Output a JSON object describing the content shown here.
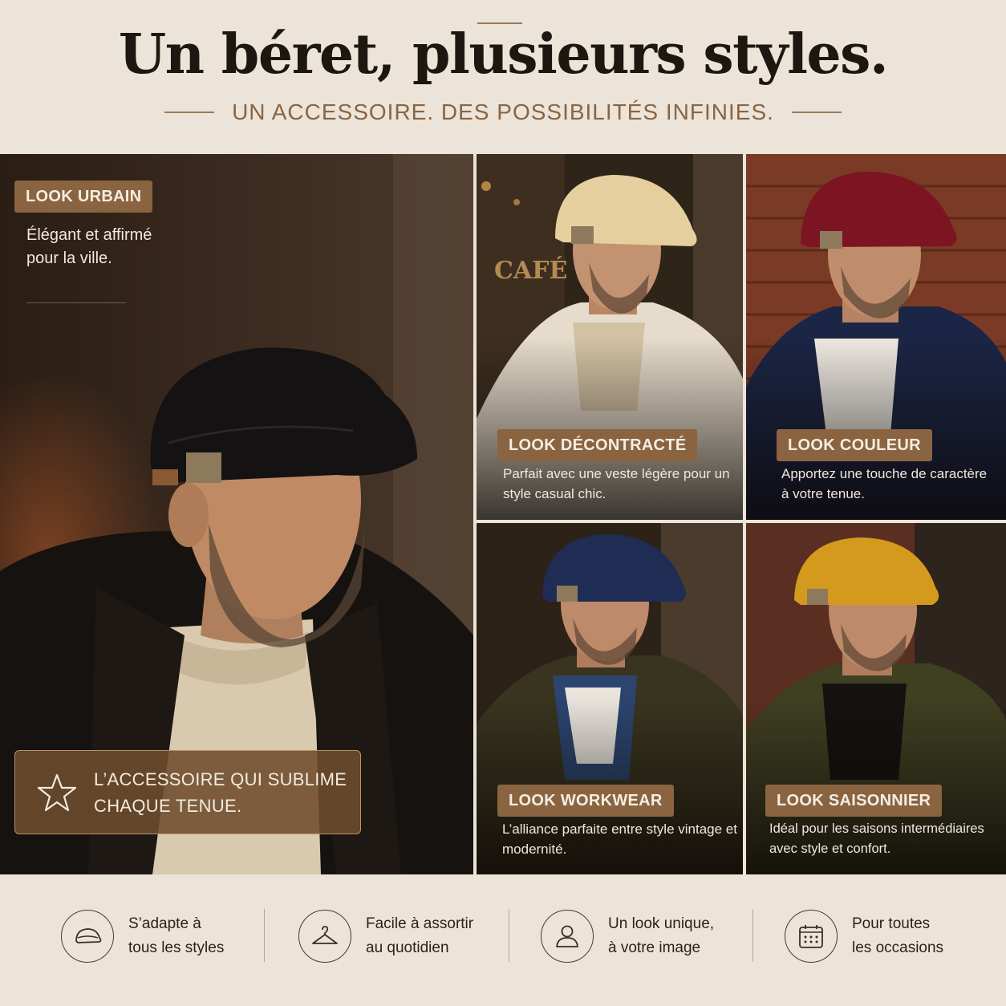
{
  "header": {
    "title": "Un béret, plusieurs styles.",
    "subtitle": "UN ACCESSOIRE. DES POSSIBILITÉS INFINIES."
  },
  "main_look": {
    "tag": "LOOK URBAIN",
    "description": "Élégant et affirmé pour la ville.",
    "callout_icon": "star-icon",
    "callout": "L’ACCESSOIRE QUI SUBLIME CHAQUE TENUE."
  },
  "looks": [
    {
      "tag": "LOOK DÉCONTRACTÉ",
      "description": "Parfait avec une veste légère pour un style casual chic.",
      "cap_color": "#e6cf9f"
    },
    {
      "tag": "LOOK COULEUR",
      "description": "Apportez une touche de caractère à votre tenue.",
      "cap_color": "#7d1421"
    },
    {
      "tag": "LOOK WORKWEAR",
      "description": "L’alliance parfaite entre style vintage et modernité.",
      "cap_color": "#1f2d55"
    },
    {
      "tag": "LOOK SAISONNIER",
      "description": "Idéal pour les saisons intermédiaires avec style et confort.",
      "cap_color": "#d49a1e"
    }
  ],
  "photo_signage": {
    "cafe_sign": "CAFÉ"
  },
  "features": [
    {
      "icon": "cap-icon",
      "line1": "S’adapte à",
      "line2": "tous les styles"
    },
    {
      "icon": "hanger-icon",
      "line1": "Facile à assortir",
      "line2": "au quotidien"
    },
    {
      "icon": "person-icon",
      "line1": "Un look unique,",
      "line2": "à votre image"
    },
    {
      "icon": "calendar-icon",
      "line1": "Pour toutes",
      "line2": "les occasions"
    }
  ],
  "colors": {
    "background": "#ece4d9",
    "accent": "#8a6440",
    "title": "#1d1712"
  }
}
